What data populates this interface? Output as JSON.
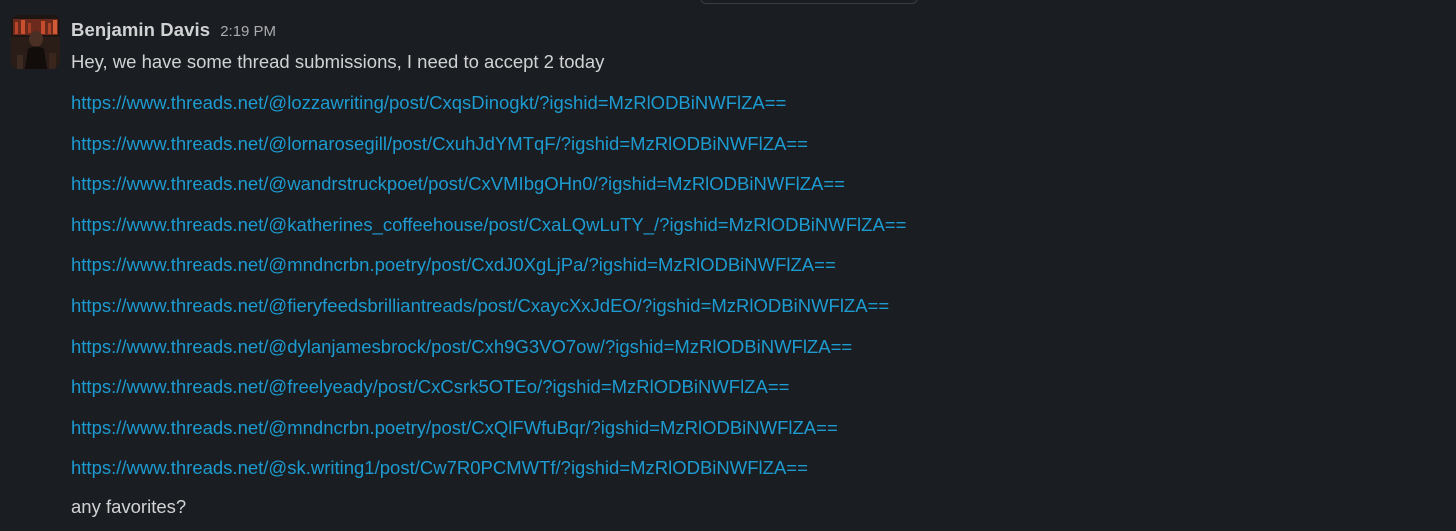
{
  "message": {
    "author": "Benjamin Davis",
    "timestamp": "2:19 PM",
    "intro": "Hey, we have some thread submissions, I need to accept 2 today",
    "links": [
      "https://www.threads.net/@lozzawriting/post/CxqsDinogkt/?igshid=MzRlODBiNWFlZA==",
      "https://www.threads.net/@lornarosegill/post/CxuhJdYMTqF/?igshid=MzRlODBiNWFlZA==",
      "https://www.threads.net/@wandrstruckpoet/post/CxVMIbgOHn0/?igshid=MzRlODBiNWFlZA==",
      "https://www.threads.net/@katherines_coffeehouse/post/CxaLQwLuTY_/?igshid=MzRlODBiNWFlZA==",
      "https://www.threads.net/@mndncrbn.poetry/post/CxdJ0XgLjPa/?igshid=MzRlODBiNWFlZA==",
      "https://www.threads.net/@fieryfeedsbrilliantreads/post/CxaycXxJdEO/?igshid=MzRlODBiNWFlZA==",
      "https://www.threads.net/@dylanjamesbrock/post/Cxh9G3VO7ow/?igshid=MzRlODBiNWFlZA==",
      "https://www.threads.net/@freelyeady/post/CxCsrk5OTEo/?igshid=MzRlODBiNWFlZA==",
      "https://www.threads.net/@mndncrbn.poetry/post/CxQlFWfuBqr/?igshid=MzRlODBiNWFlZA==",
      "https://www.threads.net/@sk.writing1/post/Cw7R0PCMWTf/?igshid=MzRlODBiNWFlZA=="
    ],
    "closing": "any favorites?"
  },
  "colors": {
    "background": "#1a1d21",
    "text": "#d1d2d3",
    "timestamp": "#ababad",
    "link": "#1d9bd1"
  }
}
